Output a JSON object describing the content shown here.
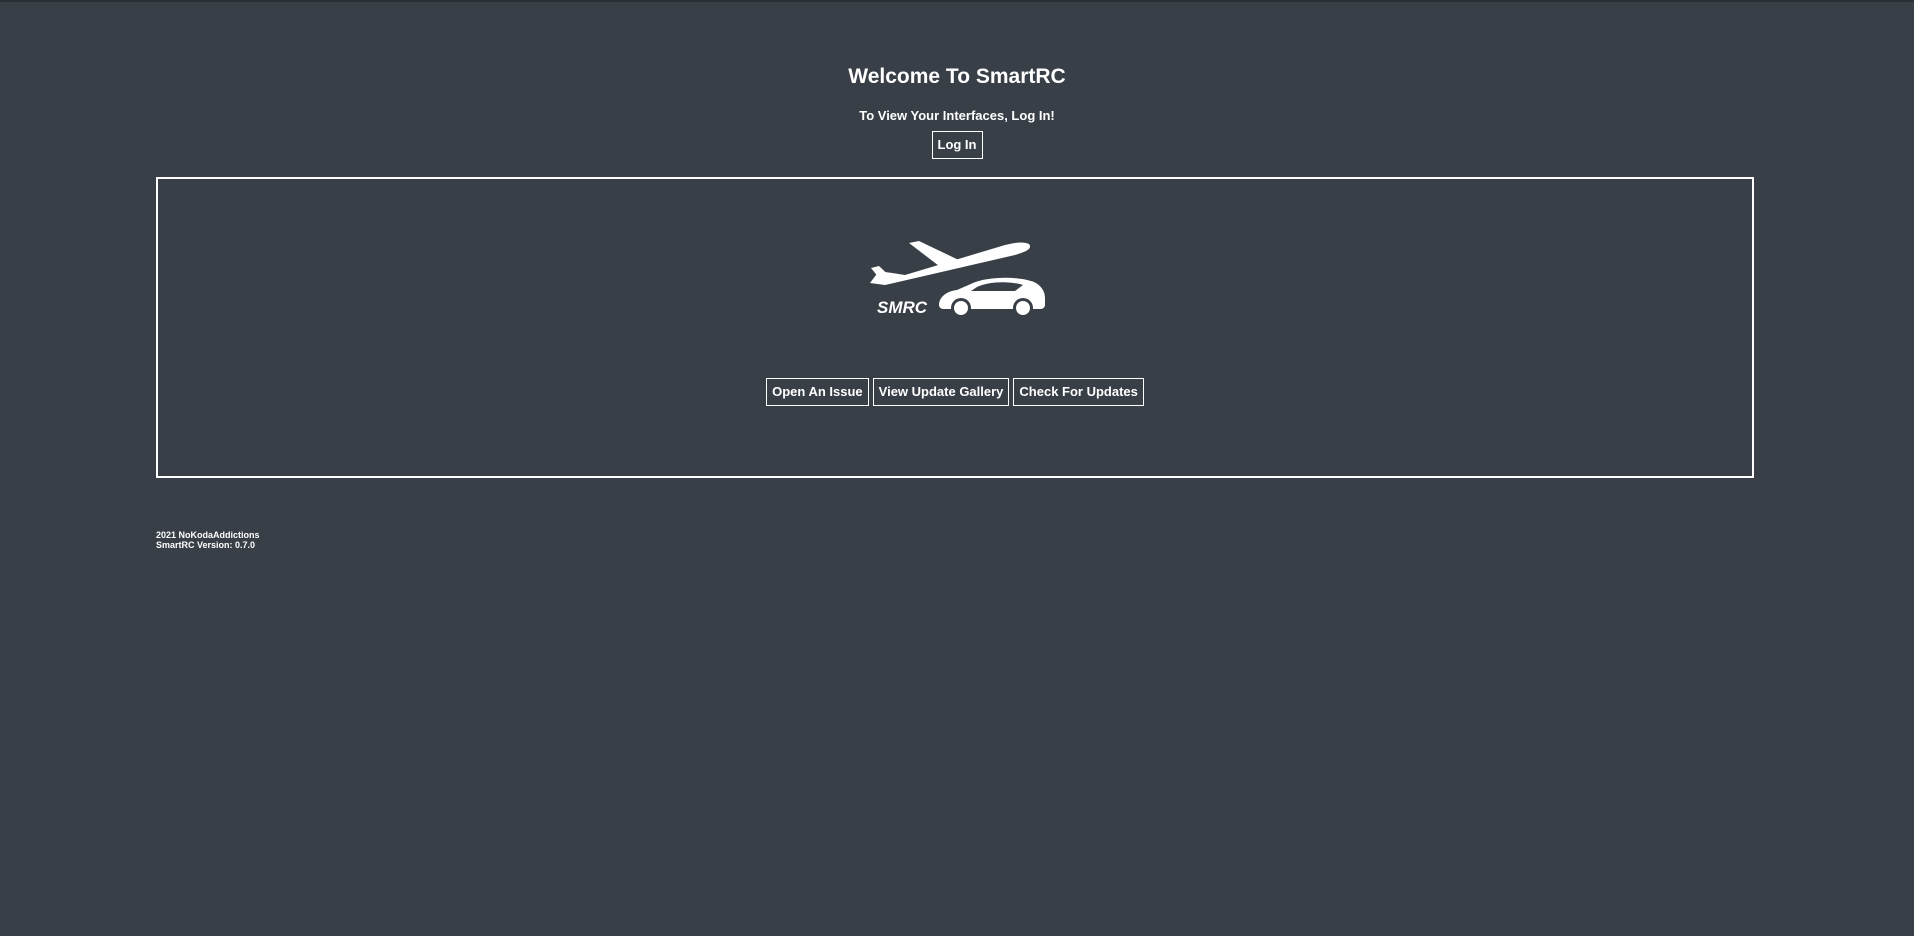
{
  "header": {
    "title": "Welcome To SmartRC",
    "subtitle": "To View Your Interfaces, Log In!",
    "login_label": "Log In"
  },
  "logo": {
    "text": "SMRC",
    "icon": "plane-and-car-logo"
  },
  "actions": {
    "open_issue_label": "Open An Issue",
    "update_gallery_label": "View Update Gallery",
    "check_updates_label": "Check For Updates"
  },
  "footer": {
    "copyright": "2021 NoKodaAddictions",
    "version": "SmartRC Version: 0.7.0"
  },
  "colors": {
    "background": "#383f47",
    "foreground": "#ffffff"
  }
}
